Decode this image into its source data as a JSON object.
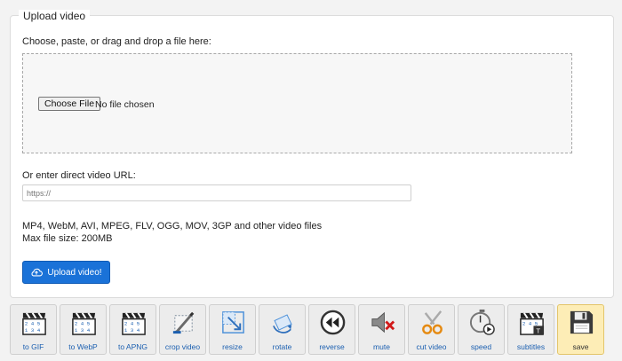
{
  "upload": {
    "legend": "Upload video",
    "choose_label": "Choose, paste, or drag and drop a file here:",
    "choose_button": "Choose File",
    "no_file": "No file chosen",
    "url_label": "Or enter direct video URL:",
    "url_placeholder": "https://",
    "formats_line1": "MP4, WebM, AVI, MPEG, FLV, OGG, MOV, 3GP and other video files",
    "formats_line2": "Max file size: 200MB",
    "upload_button": "Upload video!"
  },
  "colors": {
    "upload_button": "#1a72d8",
    "tool_link": "#1b5fb0",
    "active_tool_bg": "#fdedb6"
  },
  "toolbar": {
    "tools": [
      {
        "label": "to GIF",
        "icon": "clapperboard-icon"
      },
      {
        "label": "to WebP",
        "icon": "clapperboard-icon"
      },
      {
        "label": "to APNG",
        "icon": "clapperboard-icon"
      },
      {
        "label": "crop video",
        "icon": "crop-icon"
      },
      {
        "label": "resize",
        "icon": "resize-icon"
      },
      {
        "label": "rotate",
        "icon": "rotate-icon"
      },
      {
        "label": "reverse",
        "icon": "rewind-icon"
      },
      {
        "label": "mute",
        "icon": "mute-speaker-icon"
      },
      {
        "label": "cut video",
        "icon": "scissors-icon"
      },
      {
        "label": "speed",
        "icon": "stopwatch-icon"
      },
      {
        "label": "subtitles",
        "icon": "subtitles-clapperboard-icon"
      },
      {
        "label": "save",
        "icon": "floppy-disk-icon"
      }
    ]
  }
}
